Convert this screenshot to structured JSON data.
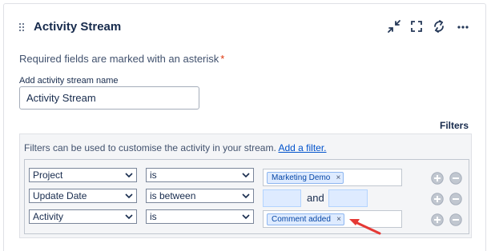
{
  "gadget": {
    "title": "Activity Stream",
    "icons": [
      "drag-handle-icon",
      "minimize-icon",
      "fullscreen-icon",
      "refresh-icon",
      "more-icon"
    ]
  },
  "form": {
    "required_note": "Required fields are marked with an asterisk",
    "required_asterisk": "*",
    "name_label": "Add activity stream name",
    "name_value": "Activity Stream"
  },
  "filters": {
    "heading": "Filters",
    "description": "Filters can be used to customise the activity in your stream.",
    "add_link": "Add a filter.",
    "and_label": "and",
    "rows": [
      {
        "field": "Project",
        "operator": "is",
        "value_tag": "Marketing Demo",
        "remove": "×"
      },
      {
        "field": "Update Date",
        "operator": "is between"
      },
      {
        "field": "Activity",
        "operator": "is",
        "value_tag": "Comment added",
        "remove": "×"
      }
    ]
  },
  "colors": {
    "accent": "#0052cc",
    "tag_bg": "#deebff",
    "annotation_arrow": "#e53935"
  }
}
